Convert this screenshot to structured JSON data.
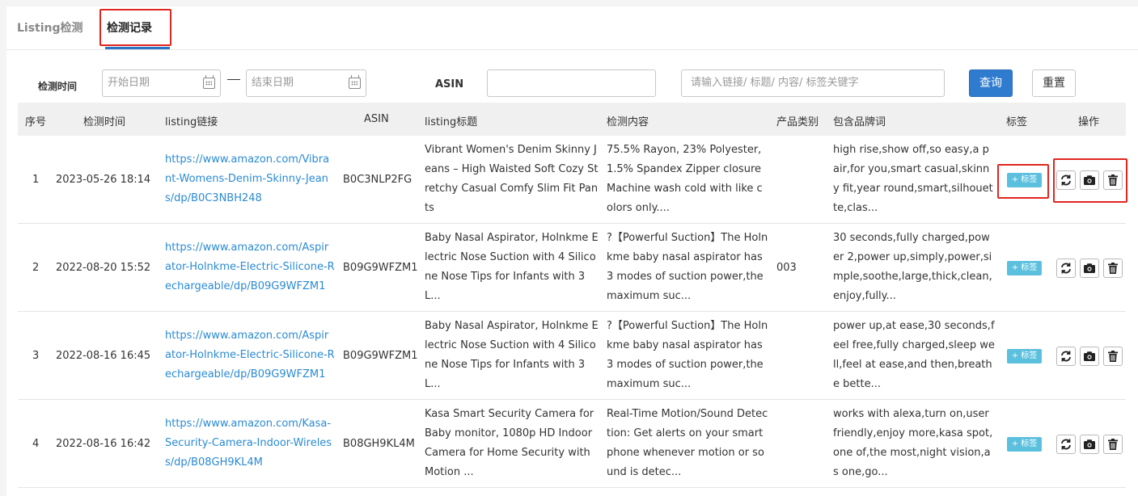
{
  "tabs": [
    {
      "label": "Listing检测"
    },
    {
      "label": "检测记录"
    }
  ],
  "filter": {
    "time_label": "检测时间",
    "start_placeholder": "开始日期",
    "end_placeholder": "结束日期",
    "asin_label": "ASIN",
    "asin_value": "",
    "keyword_placeholder": "请输入链接/ 标题/ 内容/ 标签关键字",
    "query_label": "查询",
    "reset_label": "重置"
  },
  "table": {
    "headers": [
      "序号",
      "检测时间",
      "listing链接",
      "ASIN",
      "listing标题",
      "检测内容",
      "产品类别",
      "包含品牌词",
      "标签",
      "操作"
    ],
    "tag_button_label": "+ 标签",
    "rows": [
      {
        "index": "1",
        "time": "2023-05-26 18:14",
        "link": "https://www.amazon.com/Vibrant-Womens-Denim-Skinny-Jeans/dp/B0C3NBH248",
        "asin": "B0C3NLP2FG",
        "title": "Vibrant Women's Denim Skinny Jeans – High Waisted Soft Cozy Stretchy Casual Comfy Slim Fit Pants",
        "content": "75.5% Rayon, 23% Polyester, 1.5% Spandex Zipper closure Machine wash cold with like colors only....",
        "category": "",
        "brand_words": "high rise,show off,so easy,a pair,for you,smart casual,skinny fit,year round,smart,silhouette,clas..."
      },
      {
        "index": "2",
        "time": "2022-08-20 15:52",
        "link": "https://www.amazon.com/Aspirator-Holnkme-Electric-Silicone-Rechargeable/dp/B09G9WFZM1",
        "asin": "B09G9WFZM1",
        "title": "Baby Nasal Aspirator, Holnkme Electric Nose Suction with 4 Silicone Nose Tips for Infants with 3 L...",
        "content": "?【Powerful Suction】The Holnkme baby nasal aspirator has 3 modes of suction power,the maximum suc...",
        "category": "003",
        "brand_words": "30 seconds,fully charged,power 2,power up,simply,power,simple,soothe,large,thick,clean,enjoy,fully..."
      },
      {
        "index": "3",
        "time": "2022-08-16 16:45",
        "link": "https://www.amazon.com/Aspirator-Holnkme-Electric-Silicone-Rechargeable/dp/B09G9WFZM1",
        "asin": "B09G9WFZM1",
        "title": "Baby Nasal Aspirator, Holnkme Electric Nose Suction with 4 Silicone Nose Tips for Infants with 3 L...",
        "content": "?【Powerful Suction】The Holnkme baby nasal aspirator has 3 modes of suction power,the maximum suc...",
        "category": "",
        "brand_words": "power up,at ease,30 seconds,feel free,fully charged,sleep well,feel at ease,and then,breathe bette..."
      },
      {
        "index": "4",
        "time": "2022-08-16 16:42",
        "link": "https://www.amazon.com/Kasa-Security-Camera-Indoor-Wireless/dp/B08GH9KL4M",
        "asin": "B08GH9KL4M",
        "title": "Kasa Smart Security Camera for Baby monitor, 1080p HD Indoor Camera for Home Security with Motion ...",
        "content": "Real-Time Motion/Sound Detection: Get alerts on your smart phone whenever motion or sound is detec...",
        "category": "",
        "brand_words": "works with alexa,turn on,user friendly,enjoy more,kasa spot,one of,the most,night vision,as one,go..."
      }
    ]
  },
  "colors": {
    "primary": "#2f7bcd",
    "link": "#2a8ad4",
    "tag": "#5bc0de",
    "highlight": "#e0261f"
  }
}
